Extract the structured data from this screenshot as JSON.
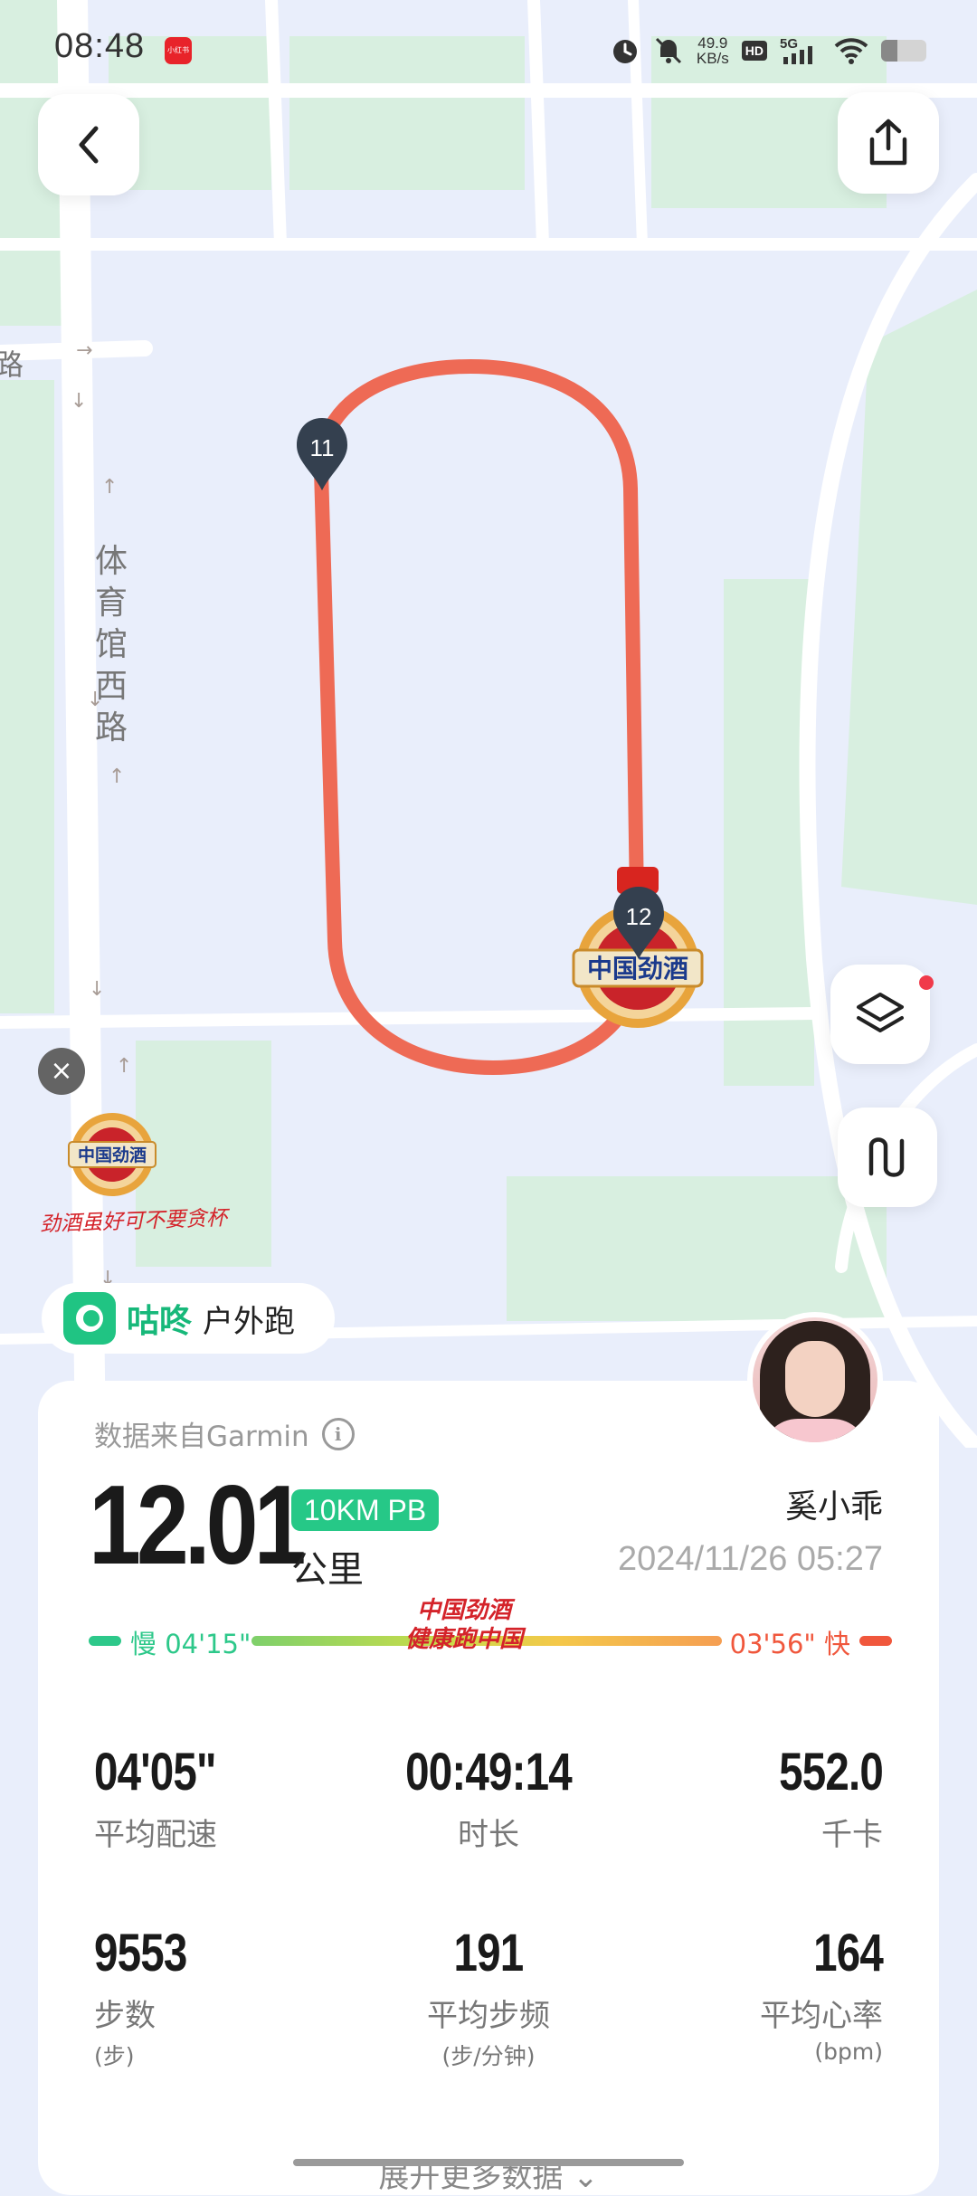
{
  "status_bar": {
    "time": "08:48",
    "app_badge": "小红书",
    "net_speed_value": "49.9",
    "net_speed_unit": "KB/s",
    "hd_label": "HD",
    "network": "5G",
    "battery_level": 0.35
  },
  "map": {
    "road_label": "体育馆西路",
    "road_label_partial": "路",
    "markers": [
      "11",
      "12"
    ],
    "ad": {
      "brand": "中国劲酒",
      "slogan": "劲酒虽好可不要贪杯"
    }
  },
  "brand": {
    "name": "咕咚",
    "activity_type": "户外跑"
  },
  "card": {
    "source": "数据来自Garmin",
    "info_icon": "i",
    "distance": "12.01",
    "badge": "10KM PB",
    "unit": "公里",
    "username": "奚小乖",
    "datetime": "2024/11/26 05:27",
    "pace": {
      "slow_label": "慢 04'15\"",
      "fast_label": "03'56\" 快",
      "slogan_line1": "中国劲酒",
      "slogan_line2": "健康跑中国"
    },
    "stats": [
      {
        "value": "04'05\"",
        "label": "平均配速",
        "sub": ""
      },
      {
        "value": "00:49:14",
        "label": "时长",
        "sub": ""
      },
      {
        "value": "552.0",
        "label": "千卡",
        "sub": ""
      },
      {
        "value": "9553",
        "label": "步数",
        "sub": "(步)"
      },
      {
        "value": "191",
        "label": "平均步频",
        "sub": "(步/分钟)"
      },
      {
        "value": "164",
        "label": "平均心率",
        "sub": "(bpm)"
      }
    ],
    "expand_label": "展开更多数据"
  },
  "colors": {
    "route": "#ee6a55",
    "brand_green": "#20c483",
    "fast": "#f0573c",
    "slow": "#2dc88a"
  }
}
